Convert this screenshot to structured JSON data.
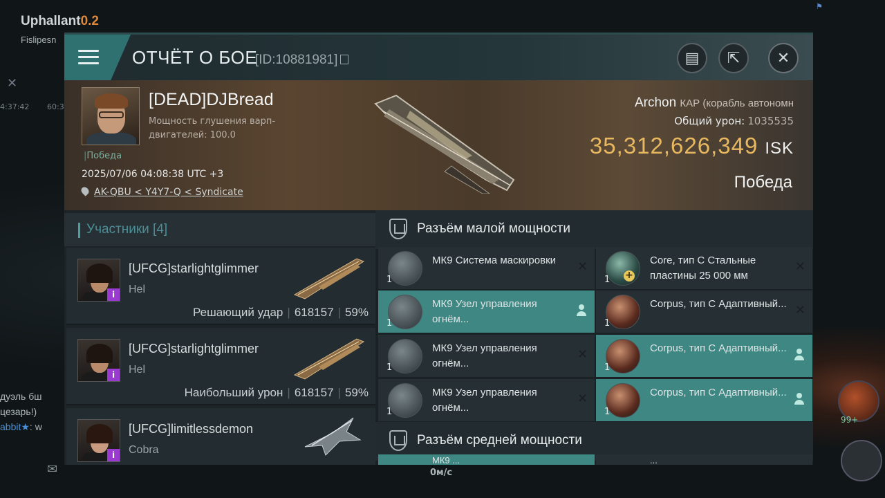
{
  "background": {
    "system_name": "Uphallant",
    "system_security": "0.2",
    "sub": "Fislipesn",
    "time_left": "4:37:42",
    "time_right": "60:3",
    "chat_line1": "дуэль бш",
    "chat_line2": "цезарь!)",
    "chat_line3_user": "abbit",
    "chat_line3_text": ": w",
    "speed": "0м/с",
    "badge": "99+"
  },
  "header": {
    "title": "ОТЧЁТ О БОЕ",
    "report_id": "[ID:10881981]"
  },
  "victim": {
    "name": "[DEAD]DJBread",
    "sub_label": "Мощность глушения варп-двигателей: 100.0",
    "status": "Победа",
    "datetime": "2025/07/06 04:08:38 UTC +3",
    "location": "AK-QBU < Y4Y7-Q < Syndicate",
    "ship_name": "Archon",
    "ship_type": "КАР (корабль автономн",
    "damage_label": "Общий урон:",
    "damage_value": "1035535",
    "isk_value": "35,312,626,349",
    "isk_unit": "ISK",
    "result": "Победа"
  },
  "participants": {
    "title": "Участники [4]",
    "rows": [
      {
        "name": "[UFCG]starlightglimmer",
        "ship": "Hel",
        "label": "Решающий удар",
        "damage": "618157",
        "percent": "59%"
      },
      {
        "name": "[UFCG]starlightglimmer",
        "ship": "Hel",
        "label": "Наибольший урон",
        "damage": "618157",
        "percent": "59%"
      },
      {
        "name": "[UFCG]limitlessdemon",
        "ship": "Cobra",
        "label": "",
        "damage": "",
        "percent": ""
      }
    ]
  },
  "modules": {
    "low_slot_title": "Разъём малой мощности",
    "mid_slot_title": "Разъём средней мощности",
    "low": [
      {
        "name": "МК9 Система маскировки",
        "qty": "1",
        "state": "destroyed",
        "side": "left"
      },
      {
        "name": "Core, тип C Стальные пластины 25 000 мм",
        "qty": "1",
        "state": "destroyed",
        "side": "right"
      },
      {
        "name": "МК9 Узел управления огнём...",
        "qty": "1",
        "state": "dropped",
        "side": "left"
      },
      {
        "name": "Corpus, тип C Адаптивный...",
        "qty": "1",
        "state": "destroyed",
        "side": "right"
      },
      {
        "name": "МК9 Узел управления огнём...",
        "qty": "1",
        "state": "destroyed",
        "side": "left"
      },
      {
        "name": "Corpus, тип C Адаптивный...",
        "qty": "1",
        "state": "dropped",
        "side": "right"
      },
      {
        "name": "МК9 Узел управления огнём...",
        "qty": "1",
        "state": "destroyed",
        "side": "left"
      },
      {
        "name": "Corpus, тип C Адаптивный...",
        "qty": "1",
        "state": "dropped",
        "side": "right"
      }
    ],
    "mid_partial": [
      {
        "name": "МК9 ..."
      },
      {
        "name": "..."
      }
    ]
  },
  "icons": {
    "menu": "menu-icon",
    "copy": "copy-icon",
    "clipboard": "clipboard-icon",
    "share": "share-icon",
    "close": "close-icon",
    "location": "location-pin-icon",
    "shield": "shield-slot-icon",
    "destroyed": "x-icon",
    "dropped": "person-icon"
  },
  "colors": {
    "accent_teal": "#3f8783",
    "isk_gold": "#e8b860",
    "corp_tag": "#9a3ad0"
  }
}
